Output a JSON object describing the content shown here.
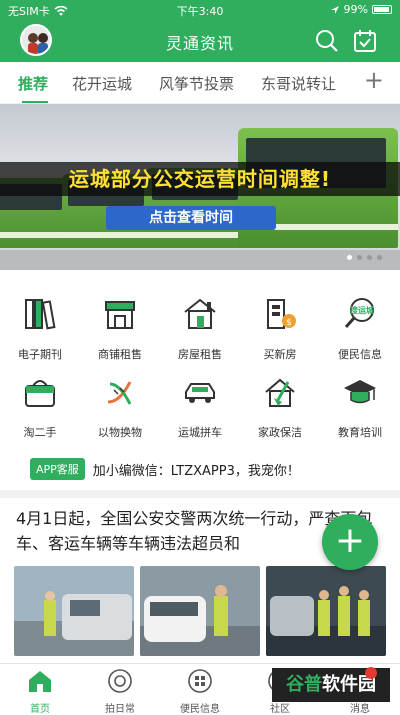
{
  "status_bar": {
    "carrier": "无SIM卡",
    "time": "下午3:40",
    "battery": "99%"
  },
  "header": {
    "title": "灵通资讯"
  },
  "tabs": [
    "推荐",
    "花开运城",
    "风筝节投票",
    "东哥说转让"
  ],
  "tab_add": "+",
  "banner": {
    "headline": "运城部分公交运营时间调整!",
    "button": "点击查看时间"
  },
  "grid": [
    {
      "label": "电子期刊",
      "icon": "magazine-icon"
    },
    {
      "label": "商铺租售",
      "icon": "shop-icon"
    },
    {
      "label": "房屋租售",
      "icon": "house-icon"
    },
    {
      "label": "买新房",
      "icon": "new-house-icon"
    },
    {
      "label": "便民信息",
      "icon": "search-yuncheng-icon",
      "tag": "搜运城"
    },
    {
      "label": "淘二手",
      "icon": "secondhand-basket-icon"
    },
    {
      "label": "以物换物",
      "icon": "exchange-icon"
    },
    {
      "label": "运城拼车",
      "icon": "car-icon"
    },
    {
      "label": "家政保洁",
      "icon": "cleaning-icon"
    },
    {
      "label": "教育培训",
      "icon": "graduation-cap-icon"
    }
  ],
  "notice": {
    "badge": "APP客服",
    "text": "加小编微信：LTZXAPP3，我宠你！"
  },
  "article": {
    "title": "4月1日起，全国公安交警两次统一行动，严查面包车、客运车辆等车辆违法超员和"
  },
  "fab": "+",
  "bottom_nav": [
    {
      "label": "首页",
      "icon": "home-icon"
    },
    {
      "label": "拍日常",
      "icon": "camera-icon"
    },
    {
      "label": "便民信息",
      "icon": "grid-icon"
    },
    {
      "label": "社区",
      "icon": "community-icon"
    },
    {
      "label": "消息",
      "icon": "message-icon"
    }
  ],
  "watermark": {
    "part1": "谷普",
    "part2": "软件园"
  },
  "colors": {
    "brand_green": "#2fae5e",
    "banner_text": "#ffe033",
    "banner_button": "#2c67c9"
  }
}
